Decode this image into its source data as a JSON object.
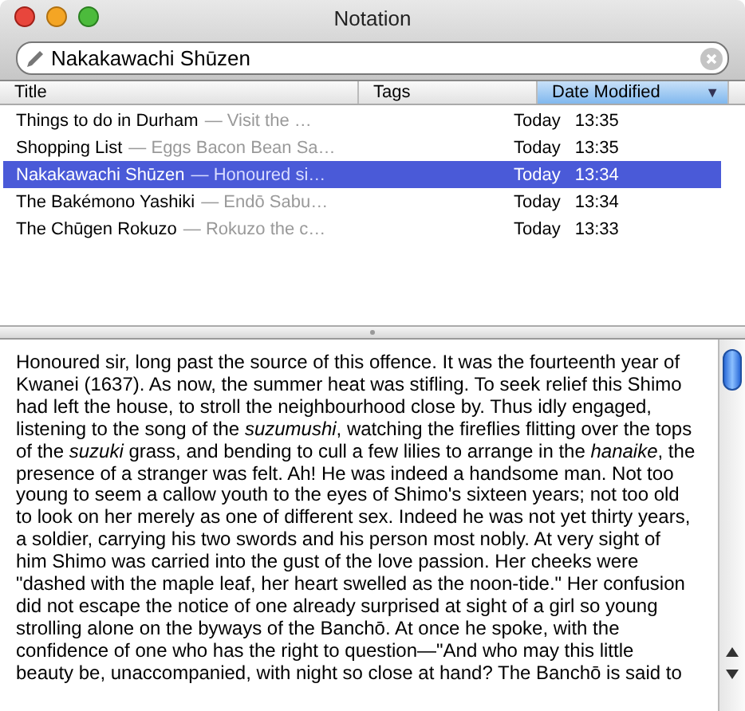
{
  "window": {
    "title": "Notation"
  },
  "search": {
    "value": "Nakakawachi Shūzen"
  },
  "table": {
    "columns": [
      {
        "label": "Title",
        "selected": false
      },
      {
        "label": "Tags",
        "selected": false
      },
      {
        "label": "Date Modified",
        "selected": true,
        "sort_indicator": "▼"
      }
    ],
    "rows": [
      {
        "title": "Things to do in Durham",
        "preview": "— Visit the …",
        "day": "Today",
        "time": "13:35",
        "selected": false
      },
      {
        "title": "Shopping List",
        "preview": "— Eggs Bacon Bean Sa…",
        "day": "Today",
        "time": "13:35",
        "selected": false
      },
      {
        "title": "Nakakawachi Shūzen",
        "preview": "— Honoured si…",
        "day": "Today",
        "time": "13:34",
        "selected": true
      },
      {
        "title": "The Bakémono Yashiki",
        "preview": "— Endō Sabu…",
        "day": "Today",
        "time": "13:34",
        "selected": false
      },
      {
        "title": "The Chūgen Rokuzo",
        "preview": "— Rokuzo the c…",
        "day": "Today",
        "time": "13:33",
        "selected": false
      }
    ]
  },
  "note": {
    "text": "Honoured sir, long past the source of this offence. It was the fourteenth year of Kwanei (1637). As now, the summer heat was stifling. To seek relief this Shimo had left the house, to stroll the neighbourhood close by. Thus idly engaged, listening to the song of the *suzumushi*, watching the fireflies flitting over the tops of the *suzuki* grass, and bending to cull a few lilies to arrange in the *hanaike*, the presence of a stranger was felt. Ah! He was indeed a handsome man. Not too young to seem a callow youth to the eyes of Shimo's sixteen years; not too old to look on her merely as one of different sex. Indeed he was not yet thirty years, a soldier, carrying his two swords and his person most nobly. At very sight of him Shimo was carried into the gust of the love passion. Her cheeks were \"dashed with the maple leaf, her heart swelled as the noon-tide.\" Her confusion did not escape the notice of one already surprised at sight of a girl so young strolling alone on the byways of the Banchō. At once he spoke, with the confidence of one who has the right to question—\"And who may this little beauty be, unaccompanied, with night so close at hand? The Banchō is said to"
  }
}
